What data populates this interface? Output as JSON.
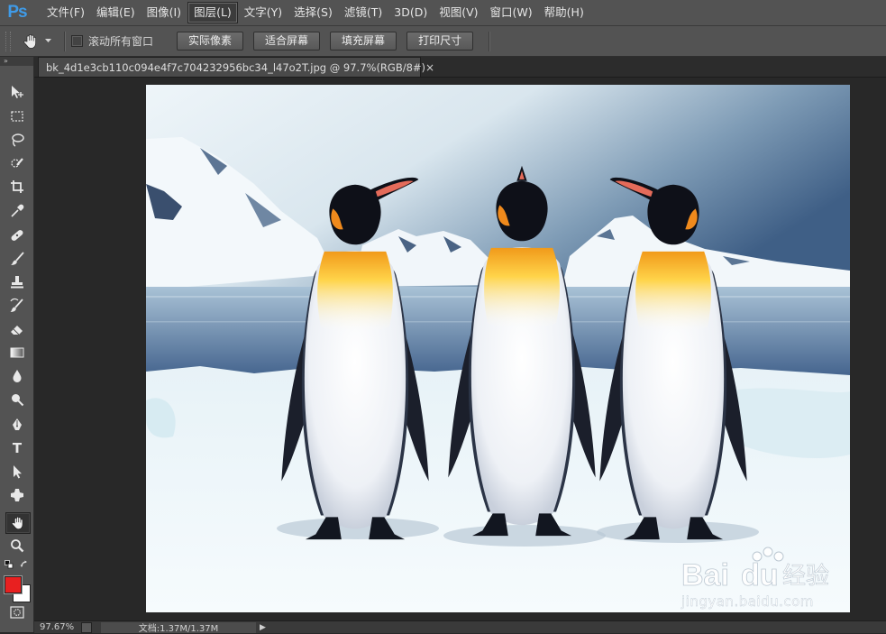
{
  "app": {
    "logo": "Ps"
  },
  "menu": [
    {
      "label": "文件(F)"
    },
    {
      "label": "编辑(E)"
    },
    {
      "label": "图像(I)"
    },
    {
      "label": "图层(L)",
      "active": true
    },
    {
      "label": "文字(Y)"
    },
    {
      "label": "选择(S)"
    },
    {
      "label": "滤镜(T)"
    },
    {
      "label": "3D(D)"
    },
    {
      "label": "视图(V)"
    },
    {
      "label": "窗口(W)"
    },
    {
      "label": "帮助(H)"
    }
  ],
  "options_bar": {
    "current_tool_icon": "hand-icon",
    "scroll_all_checkbox": {
      "label": "滚动所有窗口",
      "checked": false
    },
    "buttons": [
      "实际像素",
      "适合屏幕",
      "填充屏幕",
      "打印尺寸"
    ]
  },
  "toolbox": {
    "collapse_glyph": "»",
    "tools": [
      {
        "name": "move-tool",
        "icon": "move-icon"
      },
      {
        "name": "marquee-tool",
        "icon": "marquee-icon"
      },
      {
        "name": "lasso-tool",
        "icon": "lasso-icon"
      },
      {
        "name": "quick-select-tool",
        "icon": "quick-select-icon"
      },
      {
        "name": "crop-tool",
        "icon": "crop-icon"
      },
      {
        "name": "eyedropper-tool",
        "icon": "eyedropper-icon"
      },
      {
        "name": "healing-brush-tool",
        "icon": "bandage-icon"
      },
      {
        "name": "brush-tool",
        "icon": "brush-icon"
      },
      {
        "name": "clone-stamp-tool",
        "icon": "stamp-icon"
      },
      {
        "name": "history-brush-tool",
        "icon": "history-brush-icon"
      },
      {
        "name": "eraser-tool",
        "icon": "eraser-icon"
      },
      {
        "name": "gradient-tool",
        "icon": "gradient-icon"
      },
      {
        "name": "blur-tool",
        "icon": "drop-icon"
      },
      {
        "name": "dodge-tool",
        "icon": "dodge-icon"
      },
      {
        "name": "pen-tool",
        "icon": "pen-icon"
      },
      {
        "name": "type-tool",
        "icon": "type-icon",
        "glyph": "T"
      },
      {
        "name": "path-select-tool",
        "icon": "arrow-icon"
      },
      {
        "name": "shape-tool",
        "icon": "shape-icon"
      },
      {
        "name": "hand-tool",
        "icon": "hand-icon",
        "selected": true
      },
      {
        "name": "zoom-tool",
        "icon": "zoom-icon"
      }
    ],
    "foreground_color": "#e82020",
    "background_color": "#ffffff"
  },
  "document": {
    "tab_title": "bk_4d1e3cb110c094e4f7c704232956bc34_l47o2T.jpg @ 97.7%(RGB/8#)",
    "close_glyph": "×",
    "watermark": {
      "brand": "Bai",
      "brand2": "du",
      "product": "经验",
      "url": "jingyan.baidu.com"
    }
  },
  "status_bar": {
    "zoom": "97.67%",
    "doc_size": "文档:1.37M/1.37M",
    "arrow": "▶"
  }
}
